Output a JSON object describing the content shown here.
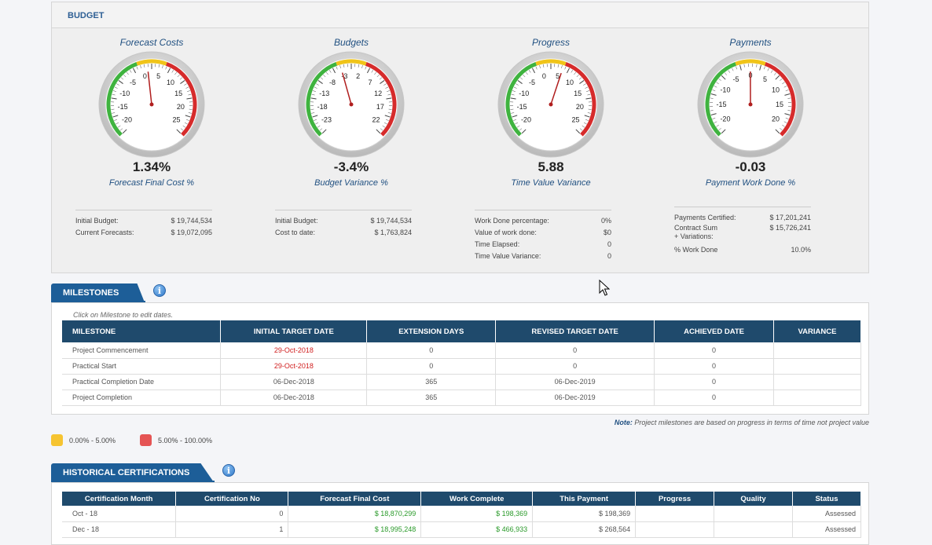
{
  "budget": {
    "header": "BUDGET",
    "gauges": [
      {
        "title": "Forecast Costs",
        "value": "1.34%",
        "subtitle": "Forecast Final Cost %",
        "ticks": [
          "-20",
          "-15",
          "-10",
          "-5",
          "0",
          "5",
          "10",
          "15",
          "20",
          "25"
        ],
        "reading": 1.34,
        "min": -22.5,
        "max": 27.5,
        "stats": [
          {
            "label": "Initial Budget:",
            "value": "$ 19,744,534"
          },
          {
            "label": "Current Forecasts:",
            "value": "$ 19,072,095"
          }
        ]
      },
      {
        "title": "Budgets",
        "value": "-3.4%",
        "subtitle": "Budget Variance %",
        "ticks": [
          "-23",
          "-18",
          "-13",
          "-8",
          "-3",
          "2",
          "7",
          "12",
          "17",
          "22"
        ],
        "reading": -3.4,
        "min": -25.5,
        "max": 24.5,
        "stats": [
          {
            "label": "Initial Budget:",
            "value": "$ 19,744,534"
          },
          {
            "label": "Cost to date:",
            "value": "$ 1,763,824"
          }
        ]
      },
      {
        "title": "Progress",
        "value": "5.88",
        "subtitle": "Time Value Variance",
        "ticks": [
          "-20",
          "-15",
          "-10",
          "-5",
          "0",
          "5",
          "10",
          "15",
          "20",
          "25"
        ],
        "reading": 5.88,
        "min": -22.5,
        "max": 27.5,
        "stats": [
          {
            "label": "Work Done percentage:",
            "value": "0%"
          },
          {
            "label": "Value of work done:",
            "value": "$0"
          },
          {
            "label": "Time Elapsed:",
            "value": "0"
          },
          {
            "label": "Time Value Variance:",
            "value": "0"
          }
        ]
      },
      {
        "title": "Payments",
        "value": "-0.03",
        "subtitle": "Payment Work Done %",
        "ticks": [
          "-20",
          "-15",
          "-10",
          "-5",
          "0",
          "5",
          "10",
          "15",
          "20"
        ],
        "reading": -0.03,
        "min": -22.5,
        "max": 22.5,
        "stats": [
          {
            "label": "Payments Certified:",
            "value": "$ 17,201,241"
          },
          {
            "label": "Contract Sum\n+ Variations:",
            "value": "$ 15,726,241",
            "tall": true
          },
          {
            "label": "% Work Done",
            "value": "10.0%"
          }
        ]
      }
    ]
  },
  "milestones": {
    "tab": "MILESTONES",
    "hint": "Click on Milestone to edit dates.",
    "columns": [
      "MILESTONE",
      "INITIAL TARGET DATE",
      "EXTENSION DAYS",
      "REVISED TARGET DATE",
      "ACHIEVED DATE",
      "VARIANCE"
    ],
    "rows": [
      {
        "name": "Project Commencement",
        "initial": "29-Oct-2018",
        "initial_red": true,
        "ext": "0",
        "revised": "0",
        "achieved": "0",
        "variance": ""
      },
      {
        "name": "Practical Start",
        "initial": "29-Oct-2018",
        "initial_red": true,
        "ext": "0",
        "revised": "0",
        "achieved": "0",
        "variance": ""
      },
      {
        "name": "Practical Completion Date",
        "initial": "06-Dec-2018",
        "initial_red": false,
        "ext": "365",
        "revised": "06-Dec-2019",
        "achieved": "0",
        "variance": ""
      },
      {
        "name": "Project Completion",
        "initial": "06-Dec-2018",
        "initial_red": false,
        "ext": "365",
        "revised": "06-Dec-2019",
        "achieved": "0",
        "variance": ""
      }
    ],
    "note_label": "Note:",
    "note_text": " Project milestones are based on progress in terms of time not project value"
  },
  "legend": [
    {
      "label": "0.00% - 5.00%",
      "color": "#f6c431"
    },
    {
      "label": "5.00% - 100.00%",
      "color": "#e55454"
    }
  ],
  "history": {
    "tab": "HISTORICAL CERTIFICATIONS",
    "columns": [
      "Certification Month",
      "Certification No",
      "Forecast Final Cost",
      "Work Complete",
      "This Payment",
      "Progress",
      "Quality",
      "Status"
    ],
    "rows": [
      {
        "month": "Oct - 18",
        "no": "0",
        "ffc": "$ 18,870,299",
        "work": "$ 198,369",
        "payment": "$ 198,369",
        "progress": "",
        "quality": "",
        "status": "Assessed"
      },
      {
        "month": "Dec - 18",
        "no": "1",
        "ffc": "$ 18,995,248",
        "work": "$ 466,933",
        "payment": "$ 268,564",
        "progress": "",
        "quality": "",
        "status": "Assessed"
      }
    ]
  },
  "icons": {
    "info": "info-icon",
    "cursor": "mouse-pointer-icon"
  }
}
